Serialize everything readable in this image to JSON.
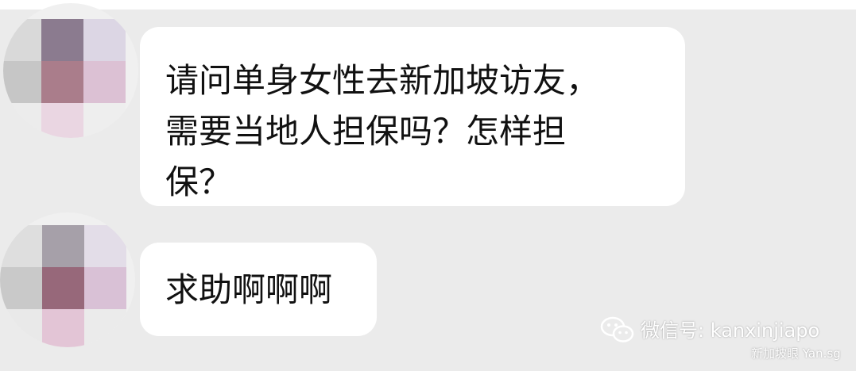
{
  "messages": [
    {
      "lines": [
        "请问单身女性去新加坡访友，",
        "需要当地人担保吗？怎样担",
        "保？"
      ],
      "avatar_colors": [
        "#d9d9d9",
        "#8b7b8f",
        "#dcd6e4",
        "#c6c6c6",
        "#aa7d8b",
        "#dcc1d4",
        "#ececec",
        "#ead6e2",
        "#eeeeee"
      ]
    },
    {
      "lines": [
        "求助啊啊啊"
      ],
      "avatar_colors": [
        "#dedede",
        "#a6a0a9",
        "#e3dde8",
        "#c9c9c9",
        "#97687a",
        "#d9c1d6",
        "#e9e9e9",
        "#e3c5d6",
        "#ebebeb"
      ]
    }
  ],
  "watermark": {
    "icon": "wechat-icon",
    "account": "微信号: kanxinjiapo",
    "source": "新加坡眼 Yan.sg"
  }
}
